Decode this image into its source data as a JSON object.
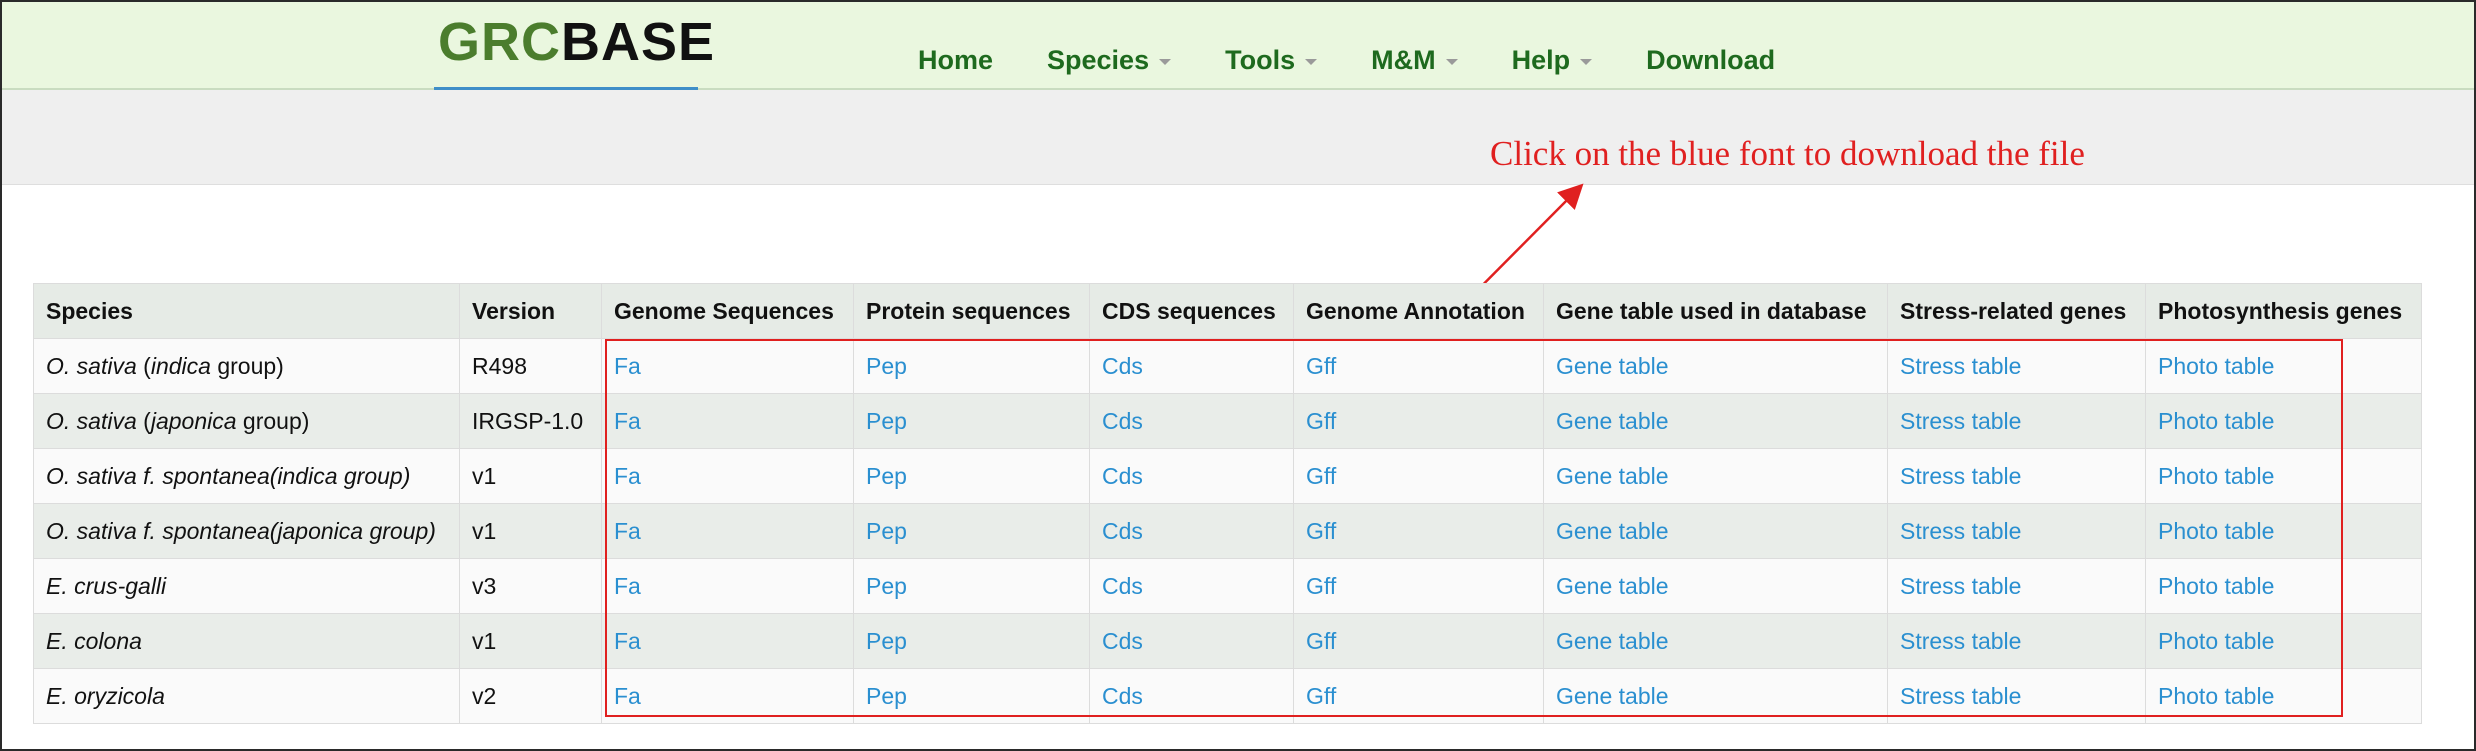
{
  "logo": {
    "part1": "GRC",
    "part2": "BASE"
  },
  "nav": {
    "home": "Home",
    "species": "Species",
    "tools": "Tools",
    "mm": "M&M",
    "help": "Help",
    "download": "Download"
  },
  "annotation": {
    "text": "Click on the blue font to download the file",
    "color": "#e02020"
  },
  "table": {
    "headers": [
      "Species",
      "Version",
      "Genome Sequences",
      "Protein sequences",
      "CDS sequences",
      "Genome Annotation",
      "Gene table used in database",
      "Stress-related genes",
      "Photosynthesis genes"
    ],
    "rows": [
      {
        "species_a": "O. sativa",
        "species_b": " (",
        "species_c": "indica",
        "species_d": " group)",
        "version": "R498",
        "genome": "Fa",
        "protein": "Pep",
        "cds": "Cds",
        "annotation": "Gff",
        "gene_table": "Gene table",
        "stress": "Stress table",
        "photo": "Photo table"
      },
      {
        "species_a": "O. sativa",
        "species_b": " (",
        "species_c": "japonica",
        "species_d": " group)",
        "version": "IRGSP-1.0",
        "genome": "Fa",
        "protein": "Pep",
        "cds": "Cds",
        "annotation": "Gff",
        "gene_table": "Gene table",
        "stress": "Stress table",
        "photo": "Photo table"
      },
      {
        "species_a": "O. sativa f. spontanea(indica group)",
        "species_b": "",
        "species_c": "",
        "species_d": "",
        "version": "v1",
        "genome": "Fa",
        "protein": "Pep",
        "cds": "Cds",
        "annotation": "Gff",
        "gene_table": "Gene table",
        "stress": "Stress table",
        "photo": "Photo table"
      },
      {
        "species_a": "O. sativa f. spontanea(japonica group)",
        "species_b": "",
        "species_c": "",
        "species_d": "",
        "version": "v1",
        "genome": "Fa",
        "protein": "Pep",
        "cds": "Cds",
        "annotation": "Gff",
        "gene_table": "Gene table",
        "stress": "Stress table",
        "photo": "Photo table"
      },
      {
        "species_a": "E. crus-galli",
        "species_b": "",
        "species_c": "",
        "species_d": "",
        "version": "v3",
        "genome": "Fa",
        "protein": "Pep",
        "cds": "Cds",
        "annotation": "Gff",
        "gene_table": "Gene table",
        "stress": "Stress table",
        "photo": "Photo table"
      },
      {
        "species_a": "E. colona",
        "species_b": "",
        "species_c": "",
        "species_d": "",
        "version": "v1",
        "genome": "Fa",
        "protein": "Pep",
        "cds": "Cds",
        "annotation": "Gff",
        "gene_table": "Gene table",
        "stress": "Stress table",
        "photo": "Photo table"
      },
      {
        "species_a": "E. oryzicola",
        "species_b": "",
        "species_c": "",
        "species_d": "",
        "version": "v2",
        "genome": "Fa",
        "protein": "Pep",
        "cds": "Cds",
        "annotation": "Gff",
        "gene_table": "Gene table",
        "stress": "Stress table",
        "photo": "Photo table"
      }
    ]
  },
  "colors": {
    "link": "#2a8fd0",
    "nav_text": "#1e6a1e",
    "logo_green": "#4b7d2d",
    "highlight_box": "#e0201f"
  }
}
